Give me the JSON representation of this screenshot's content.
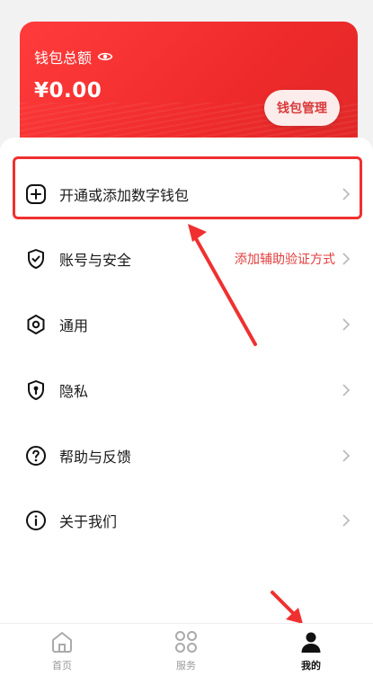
{
  "wallet": {
    "title": "钱包总额",
    "amount": "¥0.00",
    "manage_label": "钱包管理"
  },
  "menu": {
    "items": [
      {
        "label": "开通或添加数字钱包",
        "icon": "plus-circle-icon"
      },
      {
        "label": "账号与安全",
        "icon": "shield-check-icon",
        "extra": "添加辅助验证方式"
      },
      {
        "label": "通用",
        "icon": "hexagon-settings-icon"
      },
      {
        "label": "隐私",
        "icon": "privacy-keyhole-icon"
      },
      {
        "label": "帮助与反馈",
        "icon": "help-circle-icon"
      },
      {
        "label": "关于我们",
        "icon": "info-circle-icon"
      }
    ]
  },
  "tabbar": {
    "tabs": [
      {
        "label": "首页",
        "icon": "home-icon"
      },
      {
        "label": "服务",
        "icon": "grid-icon"
      },
      {
        "label": "我的",
        "icon": "user-icon",
        "active": true
      }
    ]
  },
  "colors": {
    "accent": "#ee2a2a",
    "annotation": "#f03030",
    "extra_text": "#e23c3c"
  }
}
